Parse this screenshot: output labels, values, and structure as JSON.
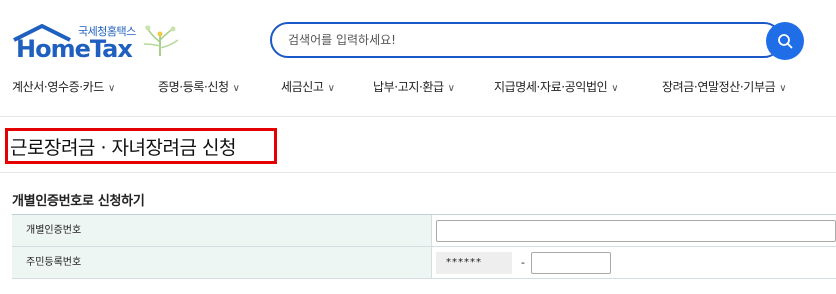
{
  "header": {
    "logo_kr": "국세청홈택스",
    "logo_en": "HomeTax",
    "search_placeholder": "검색어를 입력하세요!",
    "brand_color": "#1f5fbf"
  },
  "nav": {
    "items": [
      {
        "label": "계산서·영수증·카드",
        "chevron": "∨"
      },
      {
        "label": "증명·등록·신청",
        "chevron": "∨"
      },
      {
        "label": "세금신고",
        "chevron": "∨"
      },
      {
        "label": "납부·고지·환급",
        "chevron": "∨"
      },
      {
        "label": "지급명세·자료·공익법인",
        "chevron": "∨"
      },
      {
        "label": "장려금·연말정산·기부금",
        "chevron": "∨"
      }
    ]
  },
  "page": {
    "title": "근로장려금 · 자녀장려금 신청",
    "highlight_color": "#e60000",
    "section_title": "개별인증번호로 신청하기"
  },
  "form": {
    "rows": [
      {
        "label": "개별인증번호",
        "value": ""
      },
      {
        "label": "주민등록번호",
        "front": "******",
        "dash": "-",
        "back": ""
      }
    ]
  }
}
